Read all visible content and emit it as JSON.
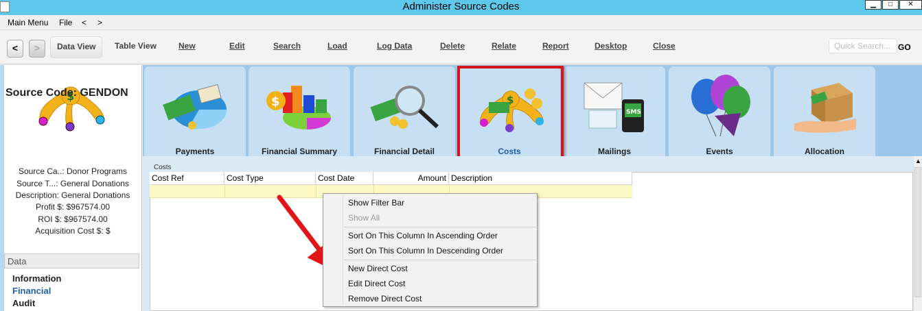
{
  "window": {
    "title": "Administer Source Codes"
  },
  "menubar": {
    "items": [
      "Main Menu",
      "File",
      "<",
      ">"
    ]
  },
  "toolbar": {
    "back": "<",
    "forward": ">",
    "buttons": {
      "data_view": "Data View",
      "table_view": "Table View",
      "new": "New",
      "edit": "Edit",
      "search": "Search",
      "load": "Load",
      "log_data": "Log Data",
      "delete": "Delete",
      "relate": "Relate",
      "report": "Report",
      "desktop": "Desktop",
      "close": "Close"
    },
    "quick_search_placeholder": "Quick Search....",
    "go": "GO"
  },
  "summary": {
    "title": "Source Code: GENDON",
    "lines": [
      "Source Ca..: Donor Programs",
      "Source T...: General Donations",
      "Description: General Donations",
      "Profit $: $967574.00",
      "ROI $: $967574.00",
      "Acquisition Cost $: $"
    ]
  },
  "leftnav": {
    "header": "Data",
    "items": [
      "Information",
      "Financial",
      "Audit"
    ],
    "active": "Financial"
  },
  "tabs": [
    "Payments",
    "Financial Summary",
    "Financial Detail",
    "Costs",
    "Mailings",
    "Events",
    "Allocation"
  ],
  "selected_tab": "Costs",
  "grid": {
    "caption": "Costs",
    "columns": [
      "Cost Ref",
      "Cost Type",
      "Cost Date",
      "Amount",
      "Description"
    ]
  },
  "context_menu": {
    "items": [
      {
        "label": "Show Filter Bar",
        "enabled": true
      },
      {
        "label": "Show All",
        "enabled": false
      },
      {
        "label": "Sort On This Column In Ascending Order",
        "enabled": true
      },
      {
        "label": "Sort On This Column In Descending Order",
        "enabled": true
      },
      {
        "label": "New Direct Cost",
        "enabled": true
      },
      {
        "label": "Edit Direct Cost",
        "enabled": true
      },
      {
        "label": "Remove Direct Cost",
        "enabled": true
      }
    ]
  },
  "colors": {
    "titlebar": "#5ec8ec",
    "highlight": "#d5151a",
    "tabs_bg": "#9cc7e8",
    "link": "#1f5fa8"
  }
}
